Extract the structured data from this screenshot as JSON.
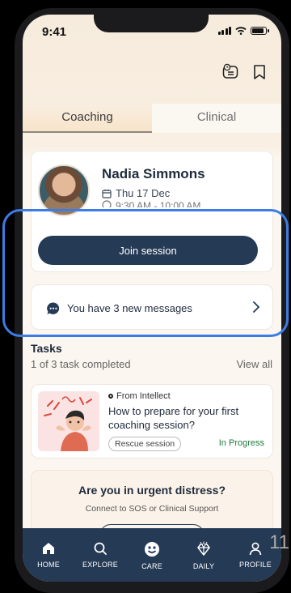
{
  "status_bar": {
    "time": "9:41"
  },
  "tabs": [
    {
      "label": "Coaching",
      "active": true
    },
    {
      "label": "Clinical",
      "active": false
    }
  ],
  "session": {
    "coach_name": "Nadia Simmons",
    "date": "Thu 17 Dec",
    "time": "9:30 AM - 10:00 AM",
    "join_label": "Join session"
  },
  "messages": {
    "text": "You have 3 new messages"
  },
  "tasks": {
    "title": "Tasks",
    "progress": "1 of 3 task completed",
    "view_all": "View all",
    "items": [
      {
        "source": "From Intellect",
        "title": "How to prepare for your first coaching session?",
        "tag": "Rescue session",
        "status": "In Progress"
      }
    ]
  },
  "distress": {
    "title": "Are you in urgent distress?",
    "subtitle": "Connect to SOS or Clinical Support"
  },
  "nav": [
    {
      "label": "HOME",
      "icon": "home-icon"
    },
    {
      "label": "EXPLORE",
      "icon": "search-icon"
    },
    {
      "label": "CARE",
      "icon": "care-icon",
      "active": true
    },
    {
      "label": "DAILY",
      "icon": "diamond-icon"
    },
    {
      "label": "PROFILE",
      "icon": "profile-icon"
    }
  ],
  "page_number": "11",
  "colors": {
    "primary": "#253a55",
    "highlight": "#3d7ce6",
    "status_green": "#1f7a3f"
  }
}
